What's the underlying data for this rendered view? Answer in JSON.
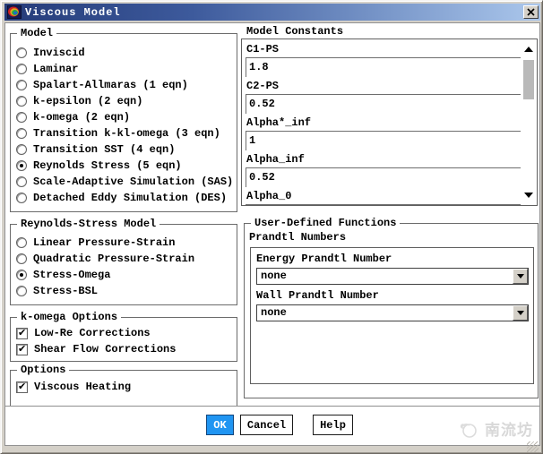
{
  "window": {
    "title": "Viscous Model"
  },
  "model_group": {
    "title": "Model",
    "options": [
      {
        "label": "Inviscid",
        "on": false
      },
      {
        "label": "Laminar",
        "on": false
      },
      {
        "label": "Spalart-Allmaras (1 eqn)",
        "on": false
      },
      {
        "label": "k-epsilon (2 eqn)",
        "on": false
      },
      {
        "label": "k-omega (2 eqn)",
        "on": false
      },
      {
        "label": "Transition k-kl-omega (3 eqn)",
        "on": false
      },
      {
        "label": "Transition SST (4 eqn)",
        "on": false
      },
      {
        "label": "Reynolds Stress (5 eqn)",
        "on": true
      },
      {
        "label": "Scale-Adaptive Simulation (SAS)",
        "on": false
      },
      {
        "label": "Detached Eddy Simulation (DES)",
        "on": false
      }
    ]
  },
  "rsm_group": {
    "title": "Reynolds-Stress Model",
    "options": [
      {
        "label": "Linear Pressure-Strain",
        "on": false
      },
      {
        "label": "Quadratic Pressure-Strain",
        "on": false
      },
      {
        "label": "Stress-Omega",
        "on": true
      },
      {
        "label": "Stress-BSL",
        "on": false
      }
    ]
  },
  "komega_group": {
    "title": "k-omega Options",
    "options": [
      {
        "label": "Low-Re Corrections",
        "on": true
      },
      {
        "label": "Shear Flow Corrections",
        "on": true
      }
    ]
  },
  "options_group": {
    "title": "Options",
    "options": [
      {
        "label": "Viscous Heating",
        "on": true
      }
    ]
  },
  "model_constants": {
    "title": "Model Constants",
    "fields": [
      {
        "label": "C1-PS",
        "value": "1.8"
      },
      {
        "label": "C2-PS",
        "value": "0.52"
      },
      {
        "label": "Alpha*_inf",
        "value": "1"
      },
      {
        "label": "Alpha_inf",
        "value": "0.52"
      },
      {
        "label": "Alpha_0",
        "value": ""
      }
    ]
  },
  "udf": {
    "title": "User-Defined Functions",
    "subtitle": "Prandtl Numbers",
    "dropdowns": [
      {
        "label": "Energy Prandtl Number",
        "value": "none"
      },
      {
        "label": "Wall Prandtl Number",
        "value": "none"
      }
    ]
  },
  "buttons": {
    "ok": "OK",
    "cancel": "Cancel",
    "help": "Help"
  },
  "watermark": {
    "text": "南流坊"
  },
  "colors": {
    "titlebar_start": "#253B79",
    "titlebar_end": "#ABC7EC",
    "ok_button": "#2095F2",
    "frame": "#D4D0C8",
    "group_border": "#6B6B6B"
  }
}
